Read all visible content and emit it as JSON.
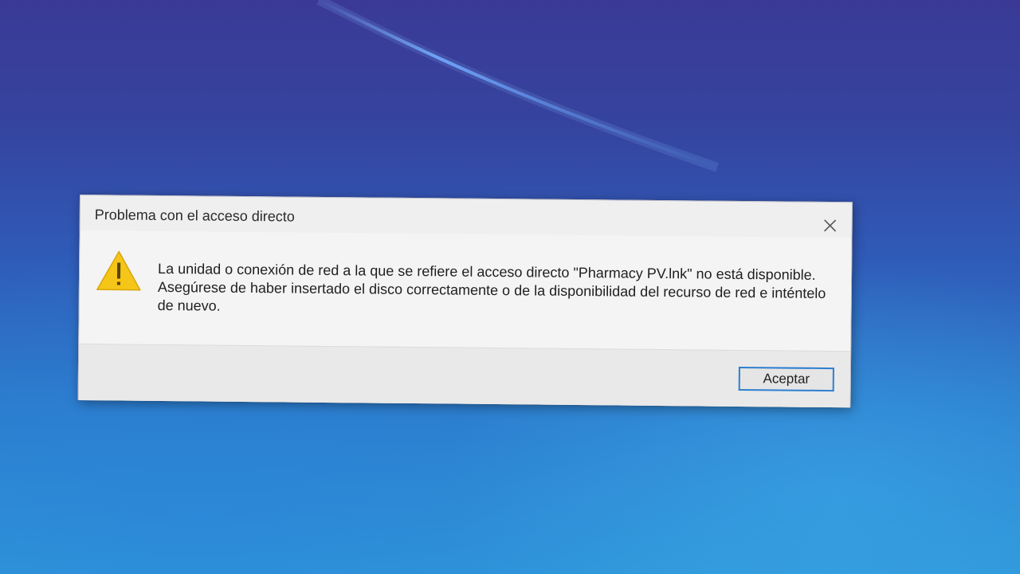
{
  "dialog": {
    "title": "Problema con el acceso directo",
    "message": "La unidad o conexión de red a la que se refiere el acceso directo \"Pharmacy PV.lnk\" no está disponible. Asegúrese de haber insertado el disco correctamente o de la disponibilidad del recurso de red e inténtelo de nuevo.",
    "icon": "warning-icon",
    "close_icon": "close-icon",
    "ok_label": "Aceptar"
  },
  "colors": {
    "desktop_top": "#3a3a96",
    "desktop_bottom": "#2f96d8",
    "dialog_bg": "#efefef",
    "button_border": "#2f7fd0",
    "warning_fill": "#f5c518"
  }
}
